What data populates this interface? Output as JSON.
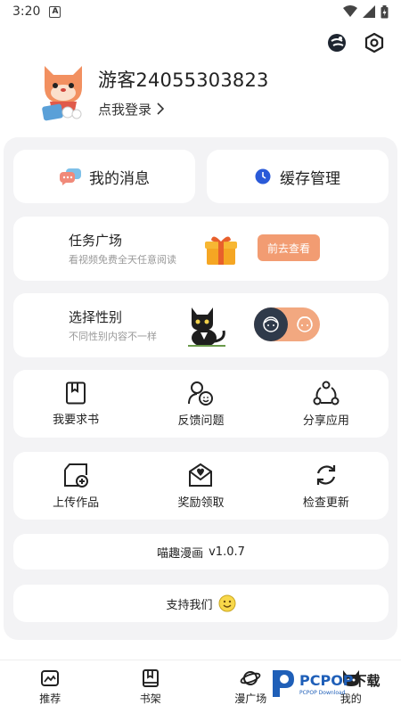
{
  "status_bar": {
    "time": "3:20",
    "badge": "A"
  },
  "profile": {
    "username": "游客24055303823",
    "login_text": "点我登录"
  },
  "cards": {
    "messages": "我的消息",
    "cache": "缓存管理"
  },
  "task": {
    "title": "任务广场",
    "subtitle": "看视频免费全天任意阅读",
    "button": "前去查看"
  },
  "gender": {
    "title": "选择性别",
    "subtitle": "不同性别内容不一样"
  },
  "grid1": [
    {
      "label": "我要求书",
      "icon": "book-request-icon"
    },
    {
      "label": "反馈问题",
      "icon": "feedback-icon"
    },
    {
      "label": "分享应用",
      "icon": "share-icon"
    }
  ],
  "grid2": [
    {
      "label": "上传作品",
      "icon": "upload-icon"
    },
    {
      "label": "奖励领取",
      "icon": "reward-icon"
    },
    {
      "label": "检查更新",
      "icon": "refresh-icon"
    }
  ],
  "version": {
    "app_name": "喵趣漫画",
    "version": "v1.0.7"
  },
  "support": {
    "label": "支持我们"
  },
  "tabbar": [
    {
      "label": "推荐",
      "icon": "recommend-icon"
    },
    {
      "label": "书架",
      "icon": "bookshelf-icon"
    },
    {
      "label": "漫广场",
      "icon": "planet-icon"
    },
    {
      "label": "我的",
      "icon": "cat-profile-icon"
    }
  ],
  "watermark": {
    "brand": "PCPOP",
    "suffix": "下载",
    "sub": "PCPOP Download"
  },
  "colors": {
    "accent": "#f29c72",
    "panel": "#f3f3f5",
    "toggle_knob": "#2f3a4a"
  }
}
